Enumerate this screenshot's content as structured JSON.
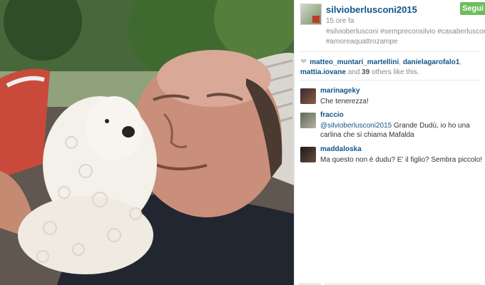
{
  "post": {
    "username": "silvioberlusconi2015",
    "follow_label": "Segui",
    "time_ago": "15 ore fa",
    "hashtags_line1": "#silvioberlusconi #sempreconsilvio #casaberluscon",
    "hashtags_line2": "#amoreaquattrozampe"
  },
  "likes": {
    "user1": "matteo_muntari_martellini",
    "sep1": ", ",
    "user2": "danielagarofalo1",
    "sep2": ",",
    "user3": "mattia.iovane",
    "and": " and ",
    "count": "39",
    "rest": " others like this."
  },
  "comments": [
    {
      "user": "marinageky",
      "text": "Che tenerezza!"
    },
    {
      "user": "fraccio",
      "mention": "@silvioberlusconi2015",
      "text": " Grande Dudù, io ho una carlina che si chiama Mafalda"
    },
    {
      "user": "maddaloska",
      "text": "Ma questo non è dudu? E' il figlio? Sembra piccolo!"
    }
  ],
  "icons": {
    "heart": "heart-icon"
  }
}
